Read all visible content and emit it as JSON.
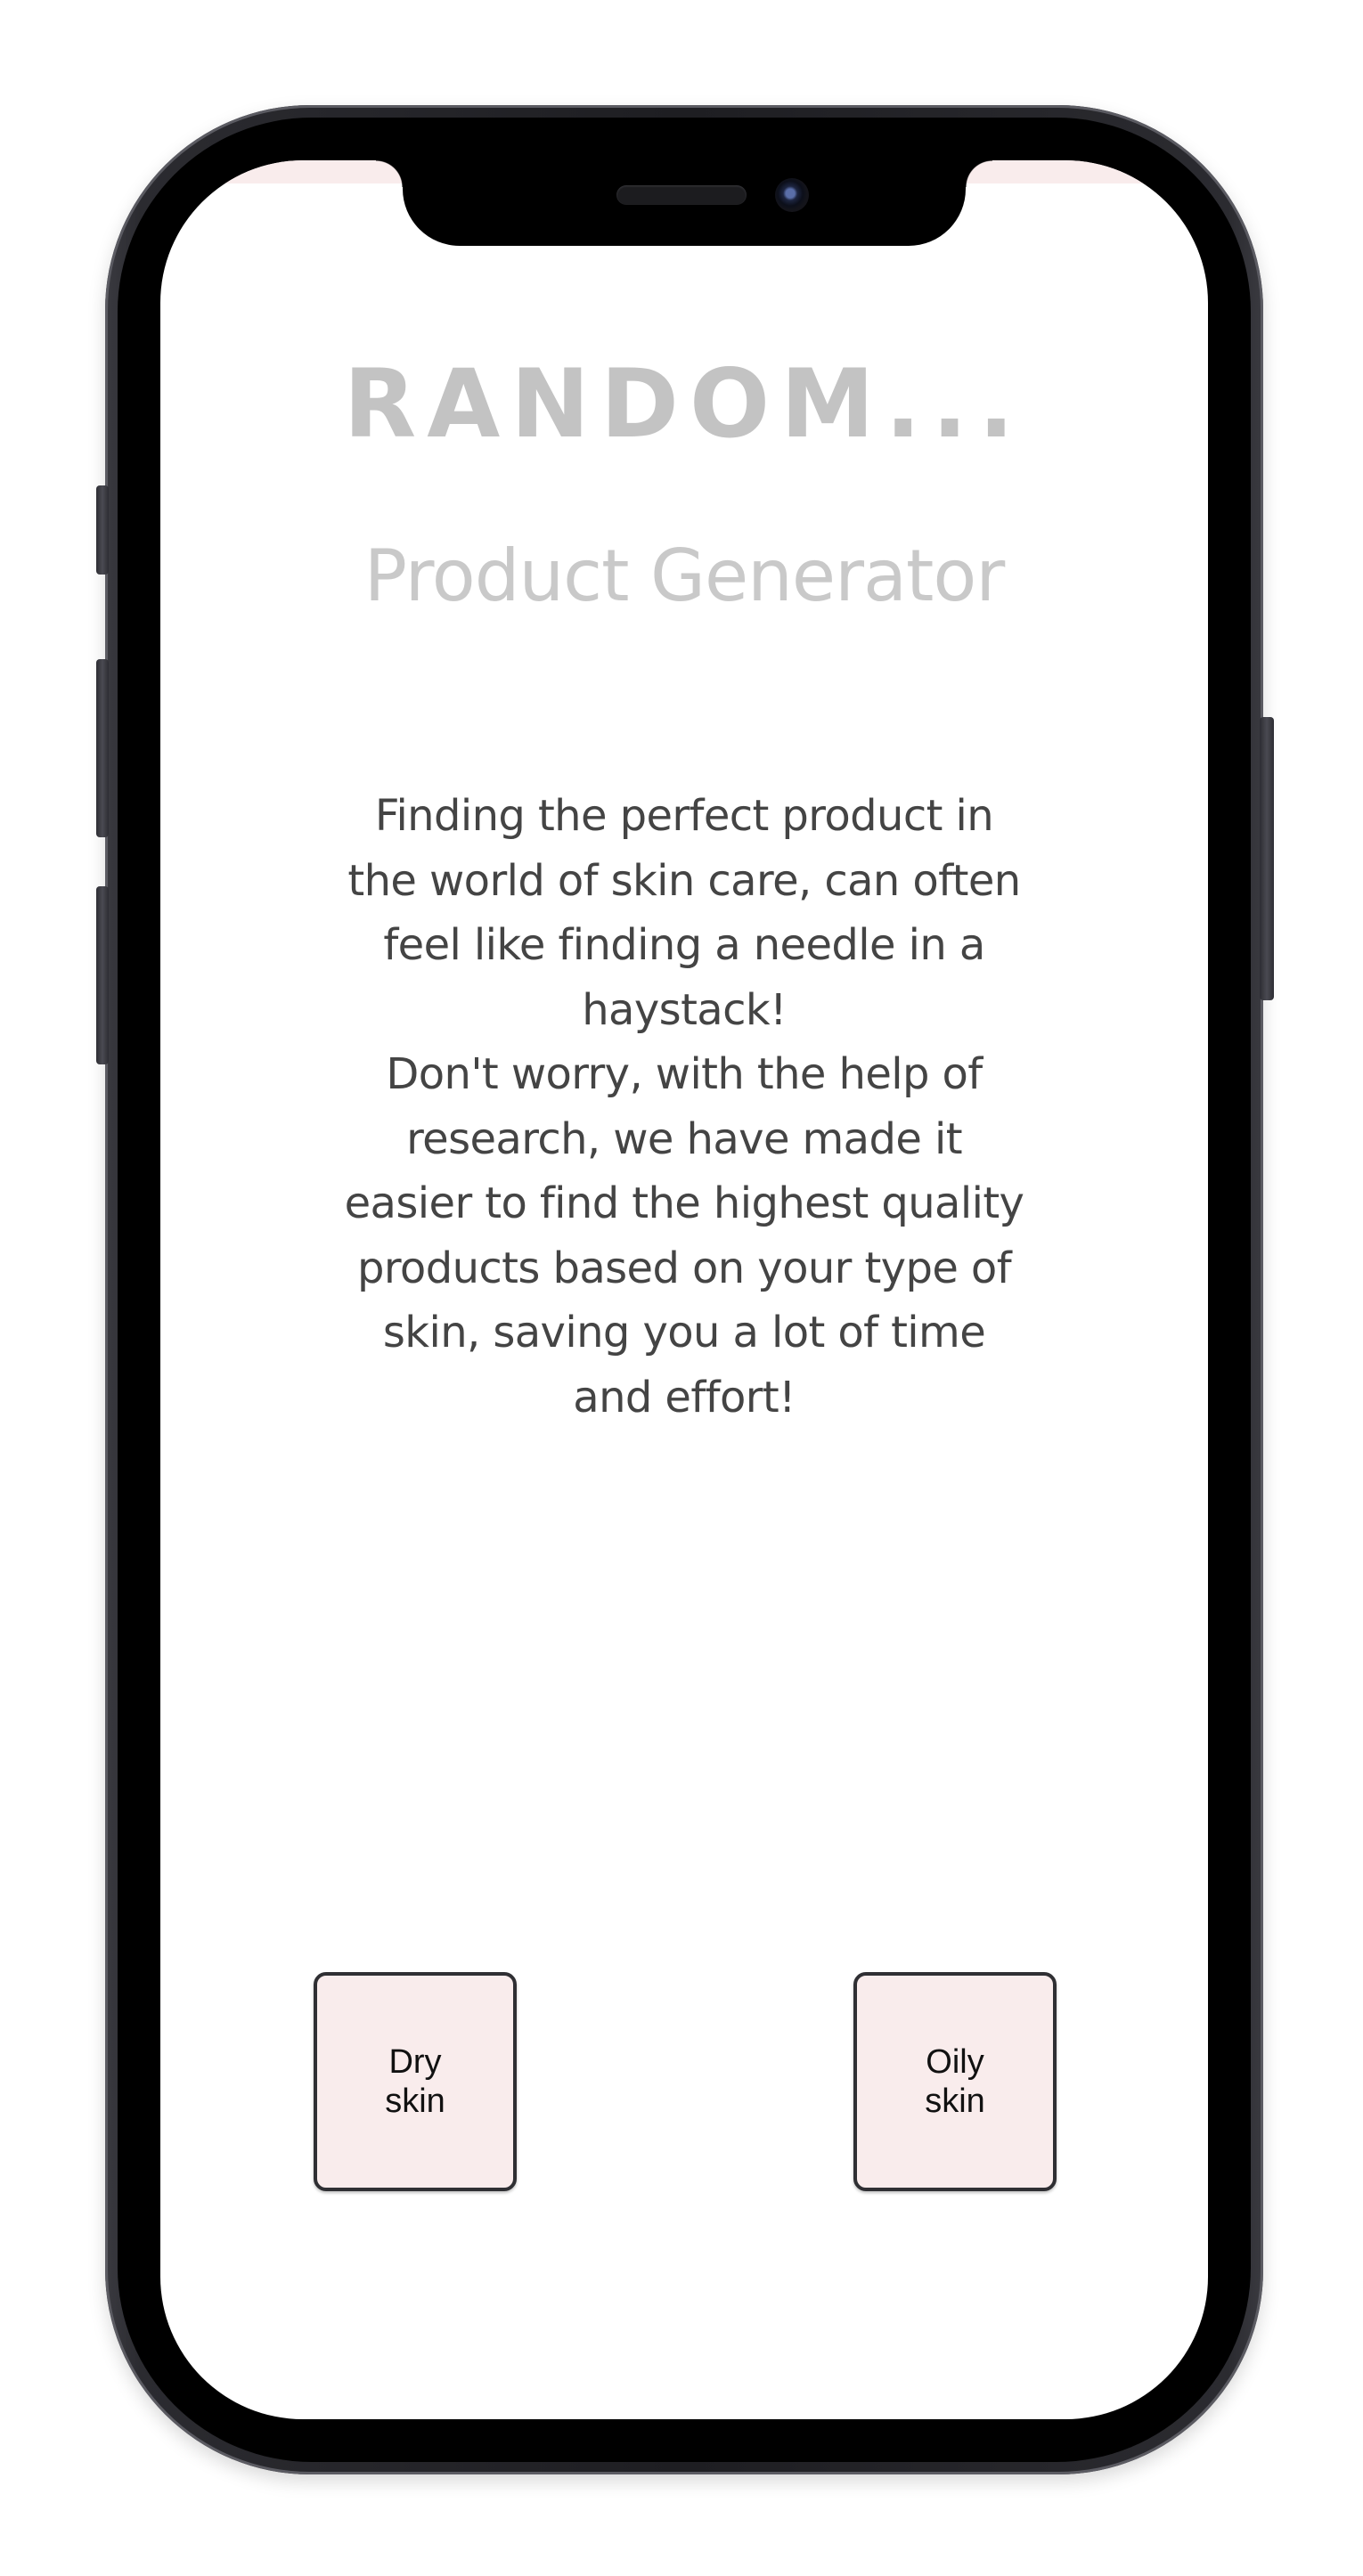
{
  "app": {
    "title": "RANDOM...",
    "subtitle": "Product Generator"
  },
  "intro": {
    "lines": [
      "Finding the perfect product in",
      "the world of skin care, can often",
      "feel like finding a needle in a",
      "haystack!",
      "Don't worry, with the help of",
      "research, we have made it",
      "easier to find the highest quality",
      "products based on your type of",
      "skin, saving you a lot of time",
      "and effort!"
    ]
  },
  "buttons": {
    "dry_label": "Dry\nskin",
    "oily_label": "Oily\nskin"
  },
  "colors": {
    "button_background": "#f9ecec",
    "title_color": "#c3c3c3",
    "body_text": "#444444"
  }
}
